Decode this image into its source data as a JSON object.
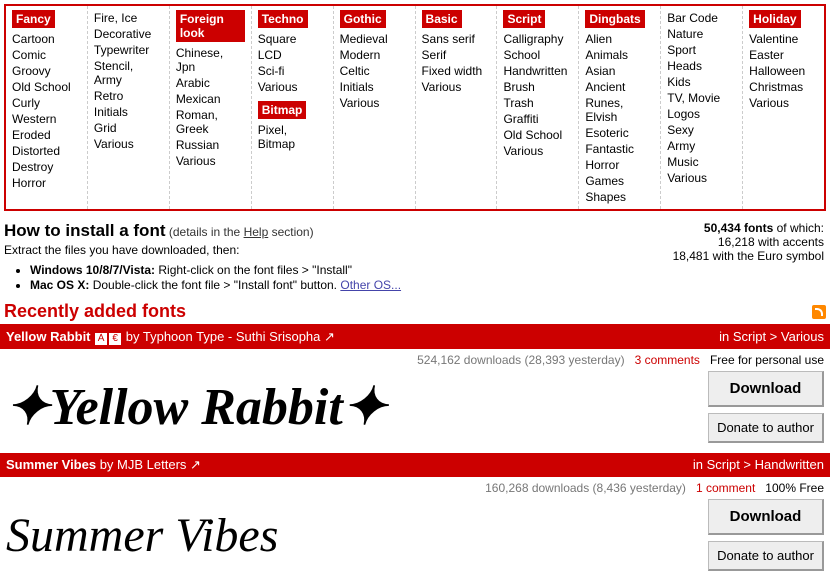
{
  "categories": [
    {
      "header": "Fancy",
      "red": true,
      "items": [
        "Cartoon",
        "Comic",
        "Groovy",
        "Old School",
        "Curly",
        "Western",
        "Eroded",
        "Distorted",
        "Destroy",
        "Horror"
      ]
    },
    {
      "header": "",
      "red": false,
      "items": [
        "Fire, Ice",
        "Decorative",
        "Typewriter",
        "Stencil, Army",
        "Retro",
        "Initials",
        "Grid",
        "Various"
      ]
    },
    {
      "header": "Foreign look",
      "red": true,
      "items": [
        "Chinese, Jpn",
        "Arabic",
        "Mexican",
        "Roman, Greek",
        "Russian",
        "Various"
      ]
    },
    {
      "header": "Techno",
      "red": true,
      "items": [
        "Square",
        "LCD",
        "Sci-fi",
        "Various"
      ],
      "header2": "Bitmap",
      "items2": [
        "Pixel, Bitmap"
      ]
    },
    {
      "header": "Gothic",
      "red": true,
      "items": [
        "Medieval",
        "Modern",
        "Celtic",
        "Initials",
        "Various"
      ]
    },
    {
      "header": "Basic",
      "red": true,
      "items": [
        "Sans serif",
        "Serif",
        "Fixed width",
        "Various"
      ]
    },
    {
      "header": "Script",
      "red": true,
      "items": [
        "Calligraphy",
        "School",
        "Handwritten",
        "Brush",
        "Trash",
        "Graffiti",
        "Old School",
        "Various"
      ]
    },
    {
      "header": "Dingbats",
      "red": true,
      "items": [
        "Alien",
        "Animals",
        "Asian",
        "Ancient",
        "Runes, Elvish",
        "Esoteric",
        "Fantastic",
        "Horror",
        "Games",
        "Shapes"
      ]
    },
    {
      "header": "",
      "red": false,
      "items": [
        "Bar Code",
        "Nature",
        "Sport",
        "Heads",
        "Kids",
        "TV, Movie",
        "Logos",
        "Sexy",
        "Army",
        "Music",
        "Various"
      ]
    },
    {
      "header": "Holiday",
      "red": true,
      "items": [
        "Valentine",
        "Easter",
        "Halloween",
        "Christmas",
        "Various"
      ]
    }
  ],
  "install": {
    "title": "How to install a font",
    "details": "(details in the ",
    "help": "Help",
    "section": " section)",
    "extract": "Extract the files you have downloaded, then:",
    "win_b": "Windows 10/8/7/Vista:",
    "win": " Right-click on the font files > \"Install\"",
    "mac_b": "Mac OS X:",
    "mac": " Double-click the font file > \"Install font\" button.  ",
    "other": "Other OS..."
  },
  "stats": {
    "l1a": "50,434 fonts",
    "l1b": " of which:",
    "l2": "16,218 with accents",
    "l3": "18,481 with the Euro symbol"
  },
  "recent": "Recently added fonts",
  "fonts": [
    {
      "name": "Yellow Rabbit",
      "by": " by Typhoon Type - Suthi Srisopha",
      "cat": "in Script > Various",
      "dl": "524,162 downloads (28,393 yesterday)",
      "cm": "3 comments",
      "lic": "Free for personal use",
      "preview": "✦Yellow Rabbit✦",
      "cls": "yr",
      "donate": true
    },
    {
      "name": "Summer Vibes",
      "by": " by MJB Letters",
      "cat": "in Script > Handwritten",
      "dl": "160,268 downloads (8,436 yesterday)",
      "cm": "1 comment",
      "lic": "100% Free",
      "preview": "Summer Vibes",
      "cls": "sv",
      "donate": true
    }
  ],
  "btn": {
    "dl": "Download",
    "donate": "Donate to author"
  }
}
